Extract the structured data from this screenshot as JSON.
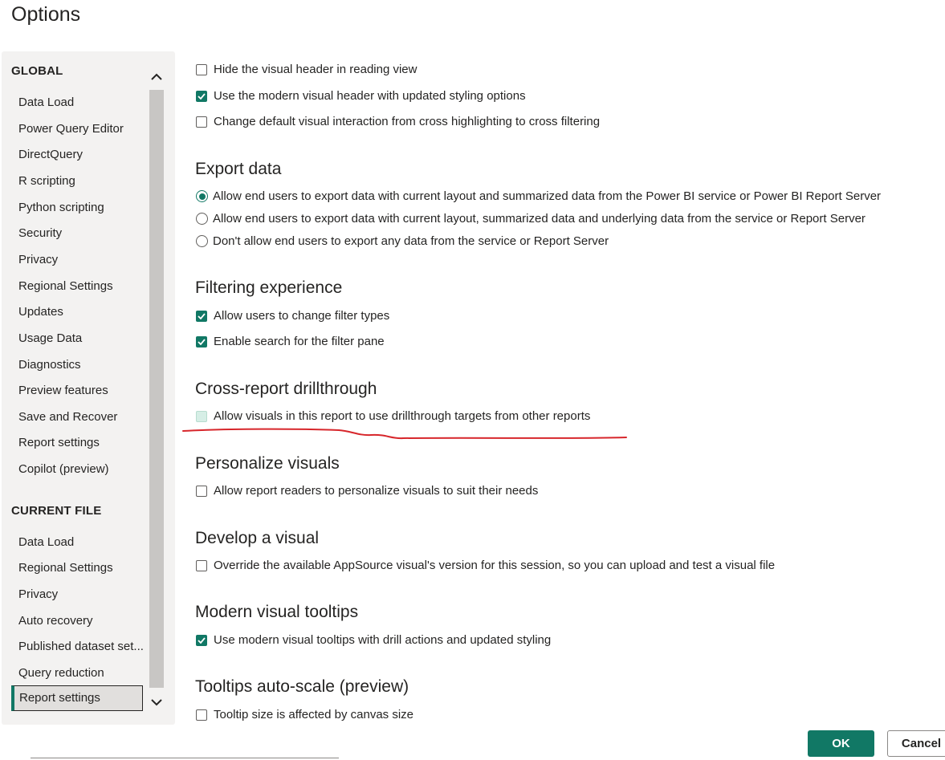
{
  "dialog": {
    "title": "Options"
  },
  "sidebar": {
    "global_label": "GLOBAL",
    "global_items": [
      "Data Load",
      "Power Query Editor",
      "DirectQuery",
      "R scripting",
      "Python scripting",
      "Security",
      "Privacy",
      "Regional Settings",
      "Updates",
      "Usage Data",
      "Diagnostics",
      "Preview features",
      "Save and Recover",
      "Report settings",
      "Copilot (preview)"
    ],
    "current_file_label": "CURRENT FILE",
    "current_file_items": [
      "Data Load",
      "Regional Settings",
      "Privacy",
      "Auto recovery",
      "Published dataset set...",
      "Query reduction",
      "Report settings"
    ],
    "selected": "Report settings"
  },
  "main": {
    "visual_options": [
      {
        "label": "Hide the visual header in reading view",
        "checked": false
      },
      {
        "label": "Use the modern visual header with updated styling options",
        "checked": true
      },
      {
        "label": "Change default visual interaction from cross highlighting to cross filtering",
        "checked": false
      }
    ],
    "export_data": {
      "heading": "Export data",
      "options": [
        {
          "label": "Allow end users to export data with current layout and summarized data from the Power BI service or Power BI Report Server",
          "selected": true
        },
        {
          "label": "Allow end users to export data with current layout, summarized data and underlying data from the service or Report Server",
          "selected": false
        },
        {
          "label": "Don't allow end users to export any data from the service or Report Server",
          "selected": false
        }
      ]
    },
    "filtering": {
      "heading": "Filtering experience",
      "options": [
        {
          "label": "Allow users to change filter types",
          "checked": true
        },
        {
          "label": "Enable search for the filter pane",
          "checked": true
        }
      ]
    },
    "cross_report": {
      "heading": "Cross-report drillthrough",
      "option": {
        "label": "Allow visuals in this report to use drillthrough targets from other reports",
        "checked": false,
        "disabled": true
      }
    },
    "personalize": {
      "heading": "Personalize visuals",
      "option": {
        "label": "Allow report readers to personalize visuals to suit their needs",
        "checked": false
      }
    },
    "develop": {
      "heading": "Develop a visual",
      "option": {
        "label": "Override the available AppSource visual's version for this session, so you can upload and test a visual file",
        "checked": false
      }
    },
    "tooltips": {
      "heading": "Modern visual tooltips",
      "option": {
        "label": "Use modern visual tooltips with drill actions and updated styling",
        "checked": true
      }
    },
    "autoscale": {
      "heading": "Tooltips auto-scale (preview)",
      "option": {
        "label": "Tooltip size is affected by canvas size",
        "checked": false
      }
    }
  },
  "footer": {
    "ok_label": "OK",
    "cancel_label": "Cancel"
  },
  "colors": {
    "accent": "#117865",
    "annotation": "#d7262b",
    "sidebar_bg": "#f3f2f1"
  },
  "icons": {
    "scroll_up": "chevron-up-icon",
    "scroll_down": "chevron-down-icon",
    "check": "checkmark-icon"
  }
}
